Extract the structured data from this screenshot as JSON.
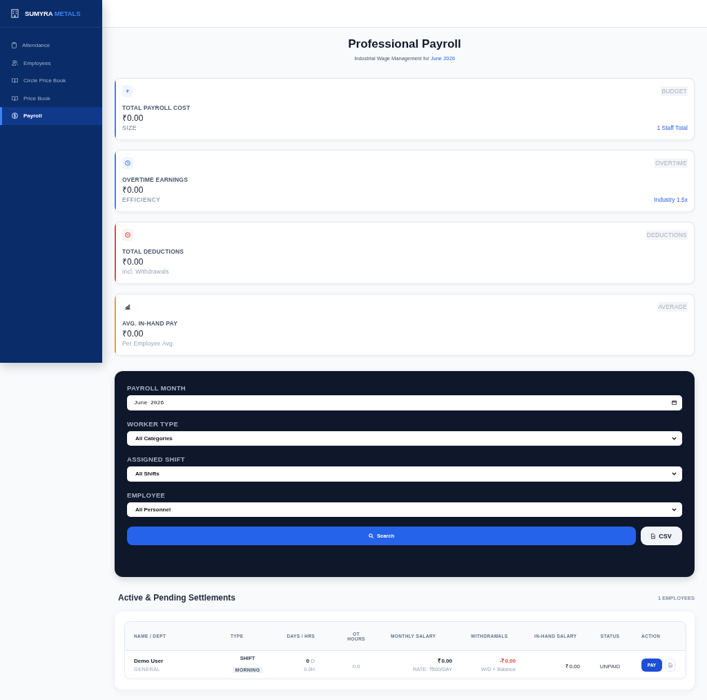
{
  "sidebar": {
    "brand": {
      "name": "SUMYRA",
      "accent": "METALS"
    },
    "items": [
      {
        "label": "Attendance",
        "selected": false
      },
      {
        "label": "Employees",
        "selected": false
      },
      {
        "label": "Circle Price Book",
        "selected": false
      },
      {
        "label": "Price Book",
        "selected": false
      },
      {
        "label": "Payroll",
        "selected": true
      }
    ]
  },
  "header": {
    "title": "Professional Payroll",
    "subtitle": "Industrial Wage Management for",
    "month": "June 2026"
  },
  "cards": [
    {
      "color": "#3b82f6",
      "tag": "BUDGET",
      "label": "TOTAL PAYROLL COST",
      "value": "₹0.00",
      "footer_label": "SIZE",
      "footer_value": "1 Staff Total"
    },
    {
      "color": "#3b82f6",
      "tag": "OVERTIME",
      "label": "OVERTIME EARNINGS",
      "value": "₹0.00",
      "footer_label": "EFFICIENCY",
      "footer_value": "Industry 1.5x"
    },
    {
      "color": "#ef4444",
      "tag": "DEDUCTIONS",
      "label": "TOTAL DEDUCTIONS",
      "value": "₹0.00",
      "note": "Incl. Withdrawals"
    },
    {
      "color": "#f59e0b",
      "tag": "AVERAGE",
      "label": "AVG. IN-HAND PAY",
      "value": "₹0.00",
      "note": "Per Employee Avg."
    }
  ],
  "filters": {
    "fields": [
      {
        "kind": "date",
        "label": "PAYROLL MONTH",
        "value": "June 2026"
      },
      {
        "kind": "select",
        "label": "WORKER TYPE",
        "value": "All Categories"
      },
      {
        "kind": "select",
        "label": "ASSIGNED SHIFT",
        "value": "All Shifts"
      },
      {
        "kind": "select",
        "label": "EMPLOYEE",
        "value": "All Personnel"
      }
    ],
    "search_button": "Search",
    "export_button": "CSV"
  },
  "settlements": {
    "title": "Active & Pending Settlements",
    "count": "1 EMPLOYEES",
    "columns": [
      "NAME / DEPT",
      "TYPE",
      "DAYS / HRS",
      "OT HOURS",
      "MONTHLY SALARY",
      "WITHDRAWALS",
      "IN-HAND SALARY",
      "STATUS",
      "ACTION"
    ],
    "rows": [
      {
        "name": "Demo User",
        "dept": "GENERAL",
        "type": "SHIFT",
        "shift": "MORNING",
        "days": "**0** D",
        "hours": "0.0H",
        "ot": "0.0",
        "salary": "₹0.00",
        "rate": "RATE: ₹500/DAY",
        "withdrawals": "-₹0.00",
        "withdrawal_note": "W/D + Balance",
        "in_hand": "₹0.00",
        "status": "UNPAID",
        "action": "PAY"
      }
    ]
  }
}
